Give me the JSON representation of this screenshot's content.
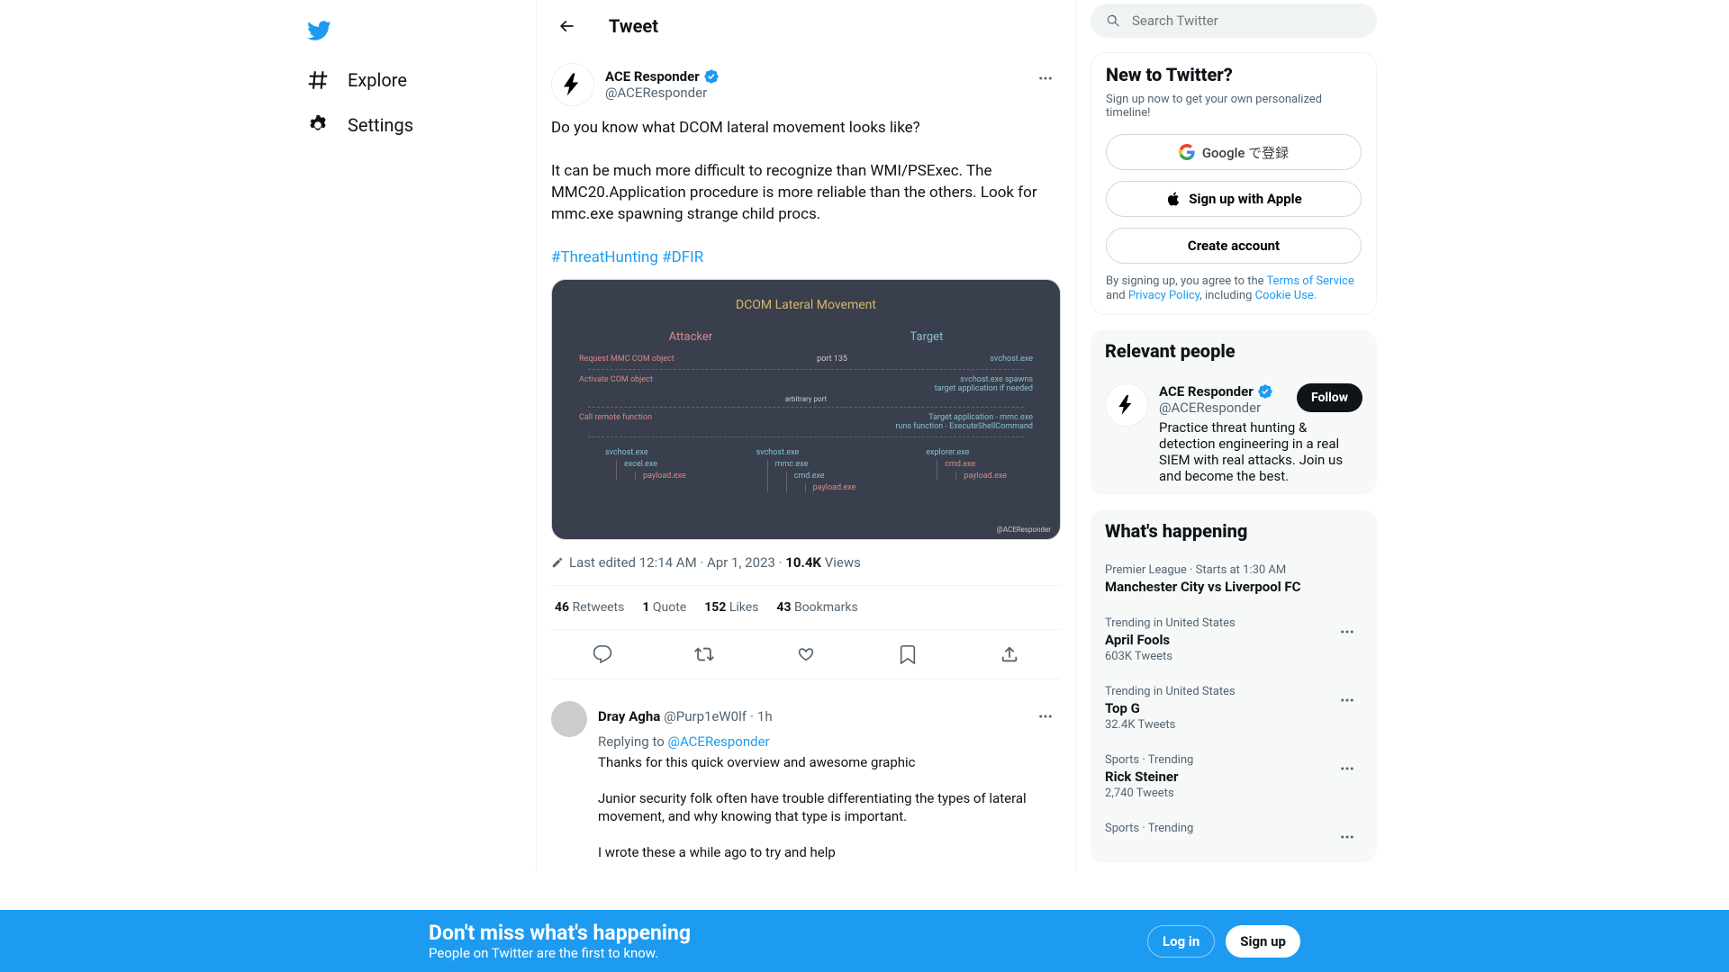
{
  "nav": {
    "explore": "Explore",
    "settings": "Settings"
  },
  "header": {
    "title": "Tweet"
  },
  "tweet": {
    "author_name": "ACE Responder",
    "author_handle": "@ACEResponder",
    "body_part1": "Do you know what DCOM lateral movement looks like?\n\nIt can be much more difficult to recognize than WMI/PSExec. The MMC20.Application procedure is more reliable than the others. Look for mmc.exe spawning strange child procs.",
    "hashtag1": "#ThreatHunting",
    "hashtag2": "#DFIR",
    "image": {
      "title": "DCOM Lateral Movement",
      "col_attacker": "Attacker",
      "col_target": "Target",
      "row1_left": "Request MMC COM object",
      "row1_mid": "port 135",
      "row1_right": "svchost.exe",
      "row2_left": "Activate COM object",
      "row2_right1": "svchost.exe spawns",
      "row2_right2": "target application if needed",
      "row2_mid": "arbitrary port",
      "row3_left": "Call remote function",
      "row3_right1": "Target application - mmc.exe",
      "row3_right2": "runs function - ExecuteShellCommand",
      "tree1_root": "svchost.exe",
      "tree1_c1": "excel.exe",
      "tree1_c2": "payload.exe",
      "tree2_root": "svchost.exe",
      "tree2_c1": "mmc.exe",
      "tree2_c2": "cmd.exe",
      "tree2_c3": "payload.exe",
      "tree3_root": "explorer.exe",
      "tree3_c1": "cmd.exe",
      "tree3_c2": "payload.exe",
      "watermark": "@ACEResponder"
    },
    "edited_label": "Last edited",
    "timestamp": "12:14 AM · Apr 1, 2023",
    "views_count": "10.4K",
    "views_label": "Views",
    "retweets_count": "46",
    "retweets_label": "Retweets",
    "quotes_count": "1",
    "quotes_label": "Quote",
    "likes_count": "152",
    "likes_label": "Likes",
    "bookmarks_count": "43",
    "bookmarks_label": "Bookmarks"
  },
  "reply": {
    "name": "Dray Agha",
    "handle": "@Purp1eW0lf",
    "time": "1h",
    "replying_label": "Replying to ",
    "replying_to": "@ACEResponder",
    "text": "Thanks for this quick overview and awesome graphic\n\nJunior security folk often have trouble differentiating the types of lateral movement, and why knowing that type is important.\n\nI wrote these a while ago to try and help"
  },
  "search": {
    "placeholder": "Search Twitter"
  },
  "signup_card": {
    "title": "New to Twitter?",
    "sub": "Sign up now to get your own personalized timeline!",
    "google": "Google で登録",
    "apple": "Sign up with Apple",
    "create": "Create account",
    "legal_prefix": "By signing up, you agree to the ",
    "terms": "Terms of Service",
    "and": " and ",
    "privacy": "Privacy Policy",
    "including": ", including ",
    "cookie": "Cookie Use."
  },
  "relevant": {
    "title": "Relevant people",
    "name": "ACE Responder",
    "handle": "@ACEResponder",
    "desc": "Practice threat hunting & detection engineering in a real SIEM with real attacks. Join us and become the best.",
    "follow": "Follow"
  },
  "happening": {
    "title": "What's happening",
    "items": [
      {
        "meta": "Premier League · Starts at 1:30 AM",
        "title": "Manchester City vs Liverpool FC",
        "count": ""
      },
      {
        "meta": "Trending in United States",
        "title": "April Fools",
        "count": "603K Tweets"
      },
      {
        "meta": "Trending in United States",
        "title": "Top G",
        "count": "32.4K Tweets"
      },
      {
        "meta": "Sports · Trending",
        "title": "Rick Steiner",
        "count": "2,740 Tweets"
      },
      {
        "meta": "Sports · Trending",
        "title": "",
        "count": ""
      }
    ]
  },
  "banner": {
    "title": "Don't miss what's happening",
    "sub": "People on Twitter are the first to know.",
    "login": "Log in",
    "signup": "Sign up"
  }
}
